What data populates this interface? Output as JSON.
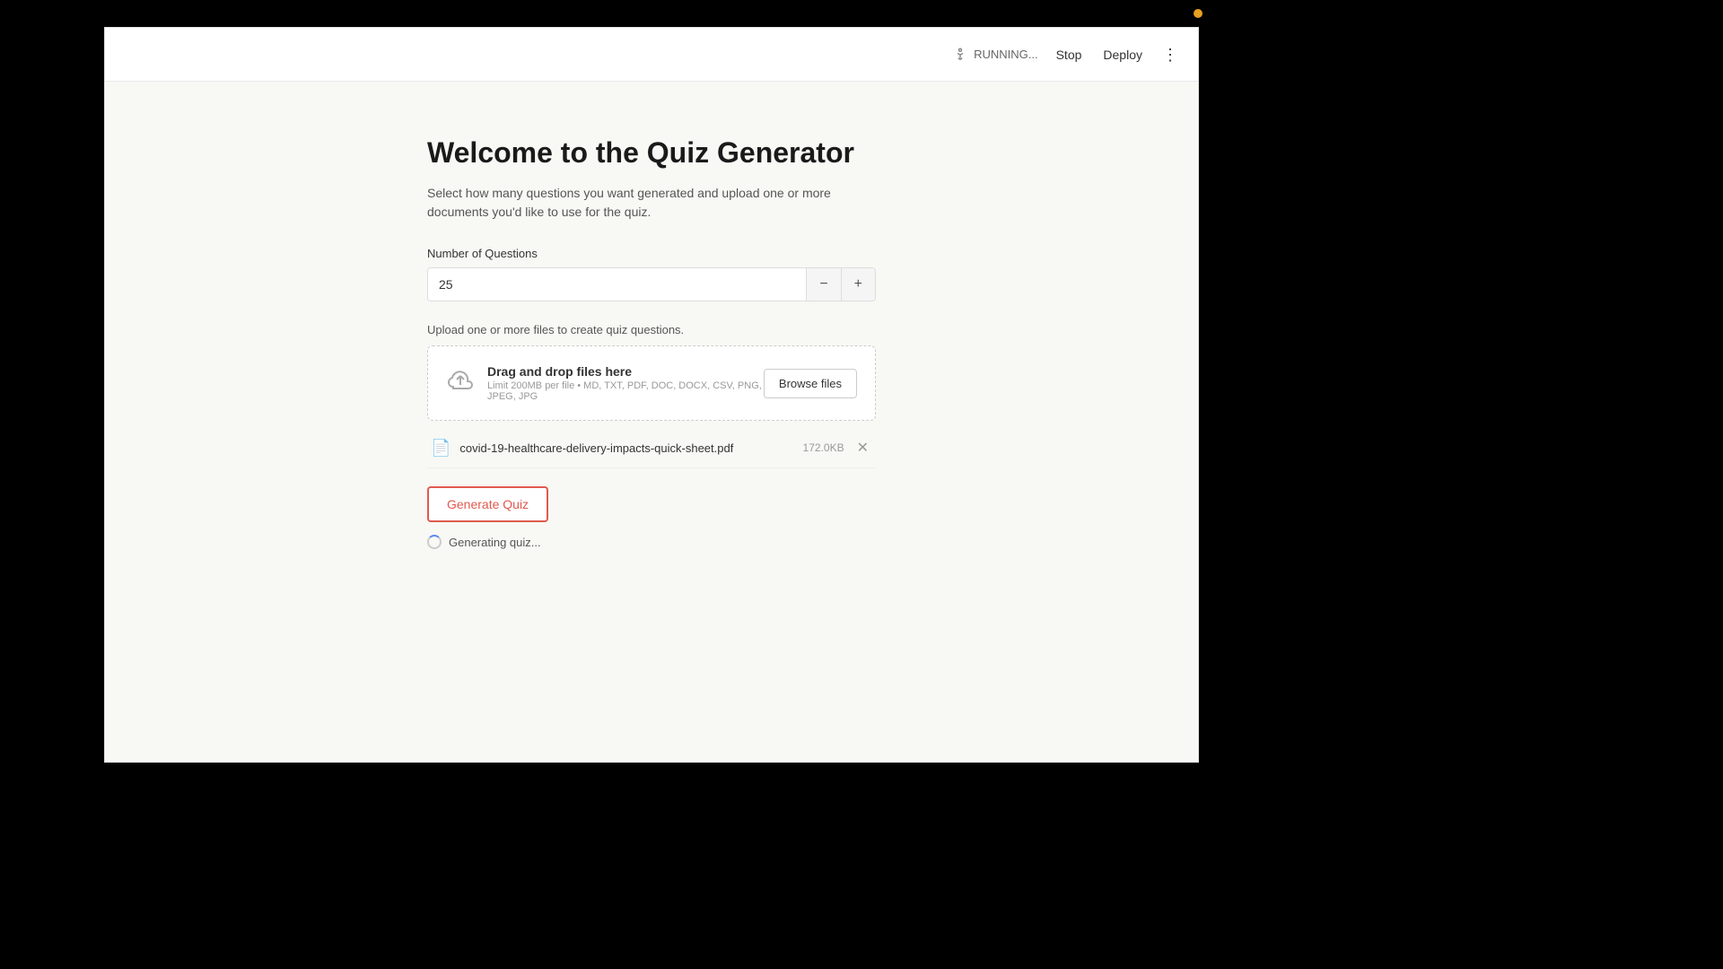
{
  "header": {
    "running_label": "RUNNING...",
    "stop_label": "Stop",
    "deploy_label": "Deploy",
    "more_icon": "⋮"
  },
  "page": {
    "title": "Welcome to the Quiz Generator",
    "subtitle": "Select how many questions you want generated and upload one or more documents you'd like to use for the quiz.",
    "number_of_questions_label": "Number of Questions",
    "number_of_questions_value": "25",
    "decrement_label": "−",
    "increment_label": "+",
    "upload_label": "Upload one or more files to create quiz questions.",
    "drop_zone_heading": "Drag and drop files here",
    "drop_zone_subtext": "Limit 200MB per file • MD, TXT, PDF, DOC, DOCX, CSV, PNG, JPEG, JPG",
    "browse_files_label": "Browse files",
    "file_name": "covid-19-healthcare-delivery-impacts-quick-sheet.pdf",
    "file_size": "172.0KB",
    "generate_btn_label": "Generate Quiz",
    "generating_status": "Generating quiz..."
  },
  "colors": {
    "accent_red": "#e05a4e",
    "spinner_blue": "#5b8bf5"
  }
}
